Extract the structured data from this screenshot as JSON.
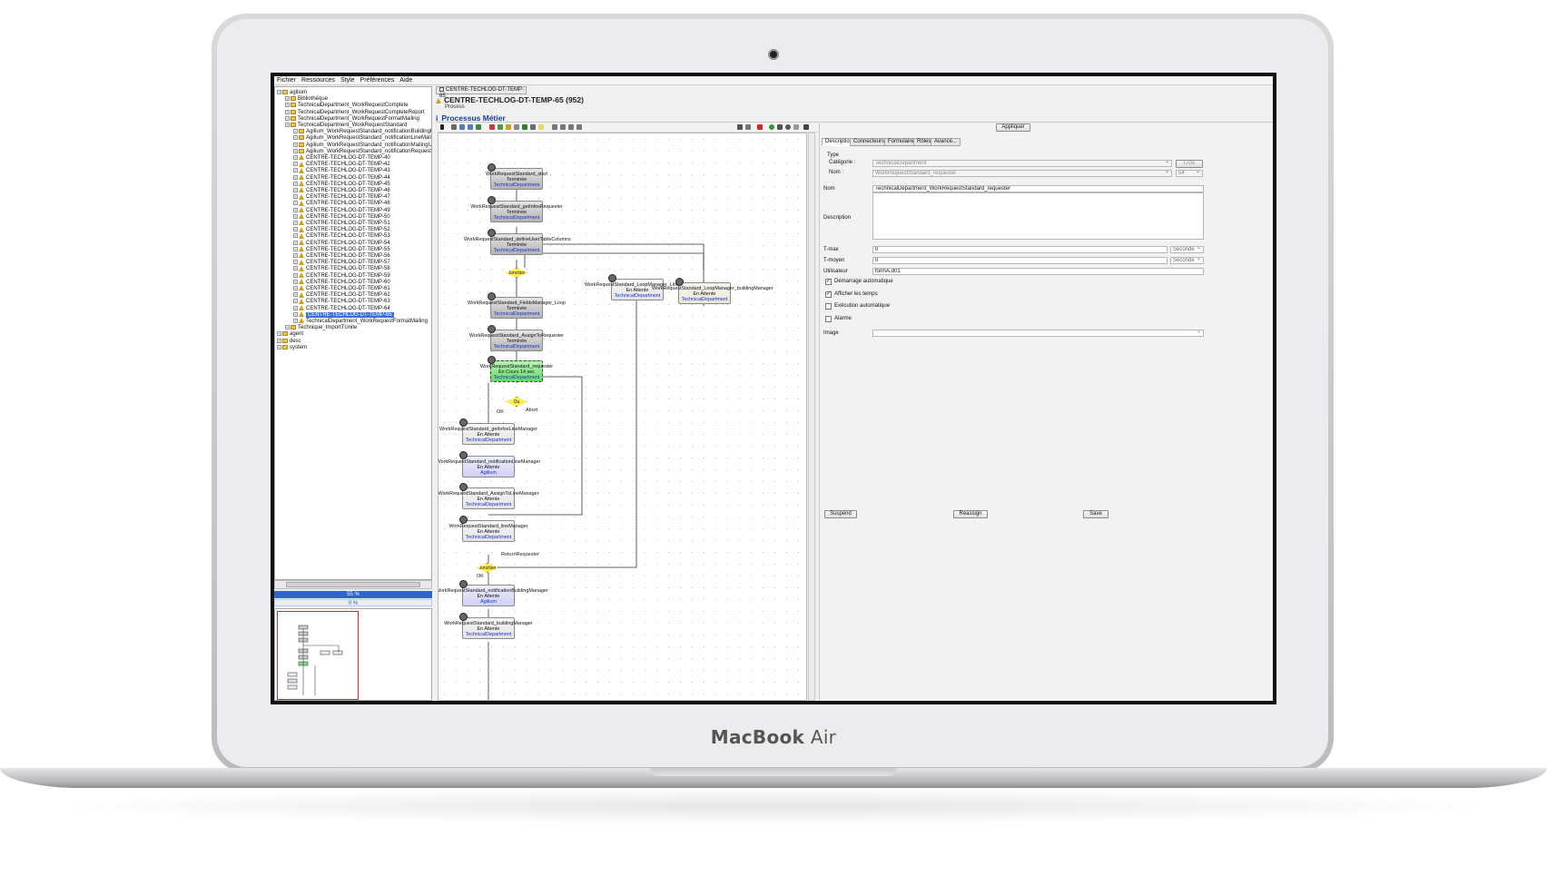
{
  "device": {
    "brand_main": "MacBook",
    "brand_sub": "Air"
  },
  "menu": [
    "Fichier",
    "Ressources",
    "Style",
    "Préférences",
    "Aide"
  ],
  "tree": [
    {
      "label": "agilium",
      "indent": 0,
      "icon": "folder"
    },
    {
      "label": "Bibliothèque",
      "indent": 1,
      "icon": "folder"
    },
    {
      "label": "TechnicalDepartment_WorkRequestComplete",
      "indent": 1,
      "icon": "folder"
    },
    {
      "label": "TechnicalDepartment_WorkRequestCompleteReport",
      "indent": 1,
      "icon": "folder"
    },
    {
      "label": "TechnicalDepartment_WorkRequestFormatMailing",
      "indent": 1,
      "icon": "folder"
    },
    {
      "label": "TechnicalDepartment_WorkRequestStandard",
      "indent": 1,
      "icon": "folder"
    },
    {
      "label": "Agilium_WorkRequestStandard_notificationBuildingM",
      "indent": 2,
      "icon": "folder"
    },
    {
      "label": "Agilium_WorkRequestStandard_notificationLineManag",
      "indent": 2,
      "icon": "folder"
    },
    {
      "label": "Agilium_WorkRequestStandard_notificationMailingUs",
      "indent": 2,
      "icon": "folder"
    },
    {
      "label": "Agilium_WorkRequestStandard_notificationRequester",
      "indent": 2,
      "icon": "folder"
    },
    {
      "label": "CENTRE-TECHLOG-DT-TEMP-40",
      "indent": 2,
      "icon": "process"
    },
    {
      "label": "CENTRE-TECHLOG-DT-TEMP-42",
      "indent": 2,
      "icon": "process"
    },
    {
      "label": "CENTRE-TECHLOG-DT-TEMP-43",
      "indent": 2,
      "icon": "process"
    },
    {
      "label": "CENTRE-TECHLOG-DT-TEMP-44",
      "indent": 2,
      "icon": "process"
    },
    {
      "label": "CENTRE-TECHLOG-DT-TEMP-45",
      "indent": 2,
      "icon": "process"
    },
    {
      "label": "CENTRE-TECHLOG-DT-TEMP-46",
      "indent": 2,
      "icon": "process"
    },
    {
      "label": "CENTRE-TECHLOG-DT-TEMP-47",
      "indent": 2,
      "icon": "process"
    },
    {
      "label": "CENTRE-TECHLOG-DT-TEMP-48",
      "indent": 2,
      "icon": "process"
    },
    {
      "label": "CENTRE-TECHLOG-DT-TEMP-49",
      "indent": 2,
      "icon": "process"
    },
    {
      "label": "CENTRE-TECHLOG-DT-TEMP-50",
      "indent": 2,
      "icon": "process"
    },
    {
      "label": "CENTRE-TECHLOG-DT-TEMP-51",
      "indent": 2,
      "icon": "process"
    },
    {
      "label": "CENTRE-TECHLOG-DT-TEMP-52",
      "indent": 2,
      "icon": "process"
    },
    {
      "label": "CENTRE-TECHLOG-DT-TEMP-53",
      "indent": 2,
      "icon": "process"
    },
    {
      "label": "CENTRE-TECHLOG-DT-TEMP-54",
      "indent": 2,
      "icon": "process"
    },
    {
      "label": "CENTRE-TECHLOG-DT-TEMP-55",
      "indent": 2,
      "icon": "process"
    },
    {
      "label": "CENTRE-TECHLOG-DT-TEMP-56",
      "indent": 2,
      "icon": "process"
    },
    {
      "label": "CENTRE-TECHLOG-DT-TEMP-57",
      "indent": 2,
      "icon": "process"
    },
    {
      "label": "CENTRE-TECHLOG-DT-TEMP-58",
      "indent": 2,
      "icon": "process"
    },
    {
      "label": "CENTRE-TECHLOG-DT-TEMP-59",
      "indent": 2,
      "icon": "process"
    },
    {
      "label": "CENTRE-TECHLOG-DT-TEMP-60",
      "indent": 2,
      "icon": "process"
    },
    {
      "label": "CENTRE-TECHLOG-DT-TEMP-61",
      "indent": 2,
      "icon": "process"
    },
    {
      "label": "CENTRE-TECHLOG-DT-TEMP-62",
      "indent": 2,
      "icon": "process"
    },
    {
      "label": "CENTRE-TECHLOG-DT-TEMP-63",
      "indent": 2,
      "icon": "process"
    },
    {
      "label": "CENTRE-TECHLOG-DT-TEMP-64",
      "indent": 2,
      "icon": "process"
    },
    {
      "label": "CENTRE-TECHLOG-DT-TEMP-65",
      "indent": 2,
      "icon": "process",
      "selected": true
    },
    {
      "label": "TechnicalDepartment_WorkRequestFormatMailing",
      "indent": 2,
      "icon": "process"
    },
    {
      "label": "Technique_ImportTUnite",
      "indent": 1,
      "icon": "folder"
    },
    {
      "label": "agent",
      "indent": 0,
      "icon": "folder"
    },
    {
      "label": "desc",
      "indent": 0,
      "icon": "folder"
    },
    {
      "label": "system",
      "indent": 0,
      "icon": "folder"
    }
  ],
  "progress": {
    "first": "55 %",
    "first_value": 0.55,
    "second": "0 %",
    "second_value": 0
  },
  "document": {
    "tab": "CENTRE-TECHLOG-DT-TEMP-65",
    "title": "CENTRE-TECHLOG-DT-TEMP-65 (952)",
    "subtitle": "Process",
    "section": "Processus Métier"
  },
  "nodes": [
    {
      "name": "WorkRequestStandard_start",
      "status": "Terminée",
      "owner": "TechnicalDepartment",
      "style": "g"
    },
    {
      "name": "WorkRequestStandard_getInfosRequester",
      "status": "Terminée",
      "owner": "TechnicalDepartment",
      "style": "g"
    },
    {
      "name": "WorkRequestStandard_defineUserTableColumns",
      "status": "Terminée",
      "owner": "TechnicalDepartment",
      "style": "g"
    },
    {
      "name": "WorkRequestStandard_FieldsManager_Loop",
      "status": "Terminée",
      "owner": "TechnicalDepartment",
      "style": "g"
    },
    {
      "name": "WorkRequestStandard_AssignToRequester",
      "status": "Terminée",
      "owner": "TechnicalDepartment",
      "style": "g"
    },
    {
      "name": "WorkRequestStandard_requester",
      "status": "En Cours 14 sec",
      "owner": "TechnicalDepartment",
      "style": "gr"
    },
    {
      "name": "WorkRequestStandard_getInfosLineManager",
      "status": "En Attente",
      "owner": "TechnicalDepartment",
      "style": "w"
    },
    {
      "name": "WorkRequestStandard_notificationLineManager",
      "status": "En Attente",
      "owner": "Agilium",
      "style": "p"
    },
    {
      "name": "WorkRequestStandard_AssignToLineManager",
      "status": "En Attente",
      "owner": "TechnicalDepartment",
      "style": "w"
    },
    {
      "name": "WorkRequestStandard_lineManager",
      "status": "En Attente",
      "owner": "TechnicalDepartment",
      "style": "w"
    },
    {
      "name": "WorkRequestStandard_notificationBuildingManager",
      "status": "En Attente",
      "owner": "Agilium",
      "style": "p"
    },
    {
      "name": "WorkRequestStandard_buildingManager",
      "status": "En Attente",
      "owner": "TechnicalDepartment",
      "style": "w"
    },
    {
      "name": "WorkRequestStandard_LoopManager_LineManager",
      "status": "En Attente",
      "owner": "TechnicalDepartment",
      "style": "w"
    },
    {
      "name": "WorkRequestStandard_LoopManager_buildingManager",
      "status": "En Attente",
      "owner": "TechnicalDepartment",
      "style": "y"
    }
  ],
  "gateways": [
    "Jonction",
    "Ou",
    "Jonction"
  ],
  "flow_labels": [
    "OK",
    "Abort",
    "ReturnRequester",
    "OK"
  ],
  "panel": {
    "apply": "Appliquer",
    "tabs": [
      "Description",
      "Connecteurs",
      "Formulaire",
      "Rôles",
      "Avancé..."
    ],
    "type_label": "Type",
    "category_label": "Catégorie :",
    "category_value": "TechnicalDepartment",
    "list_button": "Liste",
    "name_label_short": "Nom :",
    "name_value_short": "WorkRequestStandard_requester",
    "name_number": "54",
    "nom_label": "Nom",
    "nom_value": "TechnicalDepartment_WorkRequestStandard_requester",
    "description_label": "Description",
    "description_value": "",
    "tmax_label": "T-max",
    "tmax_value": "0",
    "tmax_unit": "Seconde",
    "tmoyen_label": "T-moyen",
    "tmoyen_value": "0",
    "tmoyen_unit": "Seconde",
    "user_label": "Utilisateur",
    "user_value": "formA.d01",
    "checks": [
      {
        "label": "Démarrage automatique",
        "checked": true
      },
      {
        "label": "Afficher les temps",
        "checked": true
      },
      {
        "label": "Exécution automatique",
        "checked": false
      },
      {
        "label": "Alarme",
        "checked": false
      }
    ],
    "image_label": "Image",
    "image_value": "",
    "buttons": [
      "Suspend",
      "Reassign",
      "Save"
    ]
  }
}
